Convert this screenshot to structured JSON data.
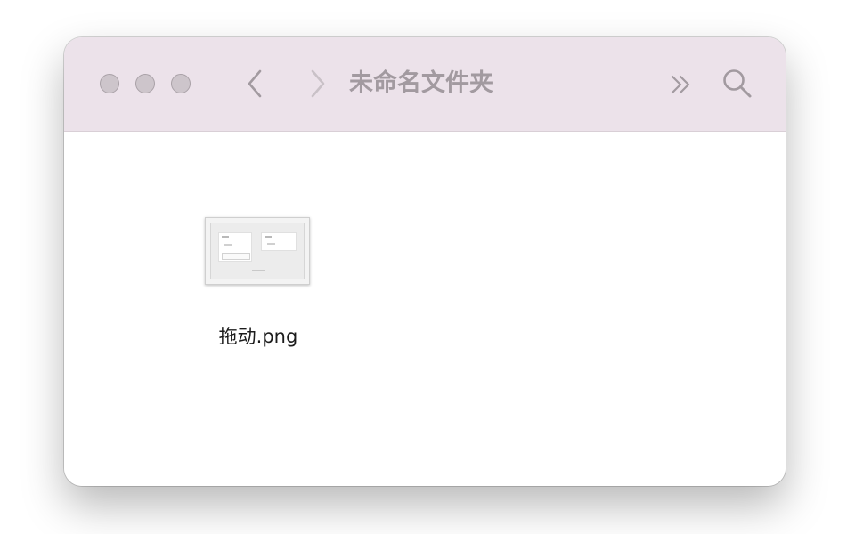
{
  "window": {
    "title": "未命名文件夹"
  },
  "toolbar": {
    "traffic_lights": [
      "close",
      "minimize",
      "zoom"
    ],
    "icons": {
      "back": "chevron-left-icon",
      "forward": "chevron-right-icon",
      "overflow": "double-chevron-right-icon",
      "search": "magnifier-icon"
    }
  },
  "files": [
    {
      "name": "拖动.png",
      "kind": "image-thumbnail"
    }
  ],
  "colors": {
    "toolbar_bg": "#ece2ea",
    "title_text": "#a29aa0",
    "icon": "#a29aa0",
    "traffic_light": "#cdc5cb",
    "content_bg": "#ffffff",
    "file_label": "#1c1c1c"
  }
}
